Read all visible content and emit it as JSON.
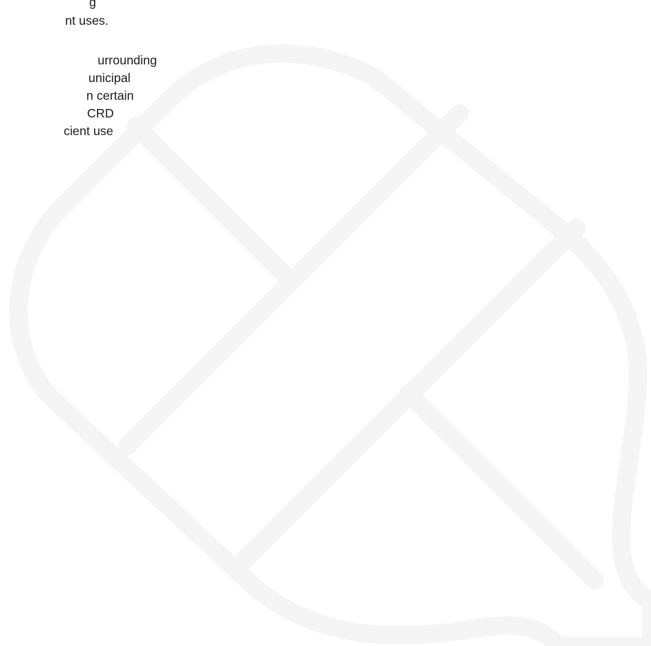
{
  "paragraph_1": {
    "lines": [
      "g",
      "nt uses."
    ]
  },
  "paragraph_2": {
    "lines": [
      "urrounding",
      "unicipal",
      "n certain",
      "CRD",
      "cient use"
    ]
  },
  "watermark": {
    "icon": "stylized-drop-or-leaf-icon",
    "stroke_color": "#f5f5f6"
  }
}
